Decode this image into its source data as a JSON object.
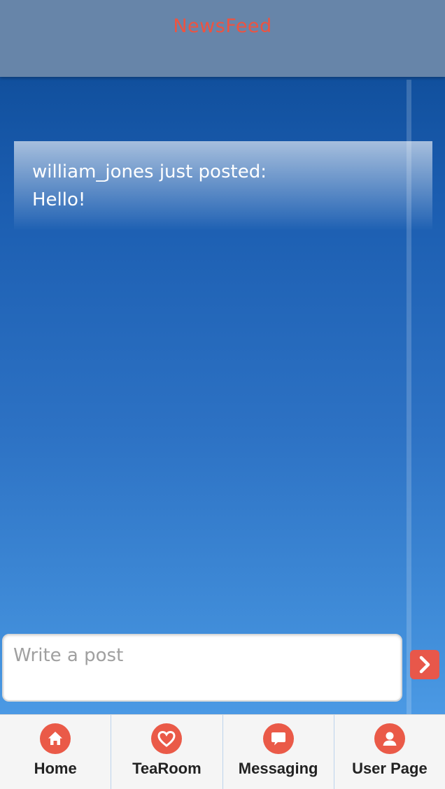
{
  "header": {
    "title": "NewsFeed"
  },
  "feed": {
    "posts": [
      {
        "author_line": "william_jones just posted:",
        "content": "Hello!"
      }
    ]
  },
  "composer": {
    "placeholder": "Write a post",
    "value": ""
  },
  "send_button": {
    "icon": "chevron-right-icon"
  },
  "tabs": [
    {
      "label": "Home",
      "icon": "home-icon"
    },
    {
      "label": "TeaRoom",
      "icon": "heart-icon"
    },
    {
      "label": "Messaging",
      "icon": "speech-bubble-icon"
    },
    {
      "label": "User Page",
      "icon": "user-icon"
    }
  ],
  "colors": {
    "accent": "#ea5a48",
    "header_bg": "#6785a9",
    "title": "#ee5340",
    "background_top": "#0a4791",
    "background_bottom": "#55a4ef"
  }
}
